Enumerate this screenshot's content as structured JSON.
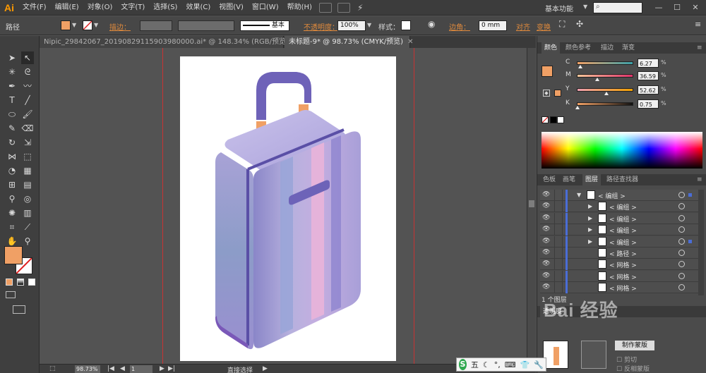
{
  "app": {
    "logo": "Ai",
    "accent": "#ff9a00"
  },
  "menu": [
    "文件(F)",
    "编辑(E)",
    "对象(O)",
    "文字(T)",
    "选择(S)",
    "效果(C)",
    "视图(V)",
    "窗口(W)",
    "帮助(H)"
  ],
  "workspace": {
    "label": "基本功能",
    "search_placeholder": ""
  },
  "control": {
    "selection_type": "路径",
    "fill_color": "#f0a065",
    "stroke_label": "描边：",
    "stroke_style": "基本",
    "opacity_label": "不透明度：",
    "opacity_value": "100%",
    "style_label": "样式：",
    "corner_label": "边角：",
    "corner_value": "0 mm",
    "align_label": "对齐",
    "transform_label": "变换"
  },
  "tabs": [
    {
      "label": "Nipic_29842067_20190829115903980000.ai* @ 148.34% (RGB/预览)",
      "active": false
    },
    {
      "label": "未标题-9* @ 98.73% (CMYK/预览)",
      "active": true
    }
  ],
  "status": {
    "zoom": "98.73%",
    "page": "1",
    "tool": "直接选择"
  },
  "color_panel": {
    "tabs": [
      "颜色",
      "颜色参考",
      "描边",
      "渐变"
    ],
    "channels": [
      {
        "name": "C",
        "value": "6.27",
        "level": 0.063
      },
      {
        "name": "M",
        "value": "36.59",
        "level": 0.366
      },
      {
        "name": "Y",
        "value": "52.62",
        "level": 0.526
      },
      {
        "name": "K",
        "value": "0.75",
        "level": 0.008
      }
    ],
    "pct": "%",
    "fill": "#f0a065"
  },
  "layers_panel": {
    "tabs": [
      "色板",
      "画笔",
      "图层",
      "路径查找器"
    ],
    "rows": [
      {
        "name": "< 编组 >",
        "expand": "▼",
        "level": 0
      },
      {
        "name": "< 编组 >",
        "expand": "▶",
        "level": 1
      },
      {
        "name": "< 编组 >",
        "expand": "▶",
        "level": 1
      },
      {
        "name": "< 编组 >",
        "expand": "▶",
        "level": 1
      },
      {
        "name": "< 编组 >",
        "expand": "▶",
        "level": 1
      },
      {
        "name": "< 路径 >",
        "expand": "",
        "level": 1
      },
      {
        "name": "< 网格 >",
        "expand": "",
        "level": 1
      },
      {
        "name": "< 网格 >",
        "expand": "",
        "level": 1
      },
      {
        "name": "< 网格 >",
        "expand": "",
        "level": 1
      }
    ],
    "count_label": "1 个图层"
  },
  "transparency_panel": {
    "tab": "透明度",
    "make_mask": "制作蒙版",
    "clip": "剪切",
    "invert_mask": "反相蒙版"
  },
  "watermark": "Bai 经验",
  "ime": {
    "label": "五"
  }
}
